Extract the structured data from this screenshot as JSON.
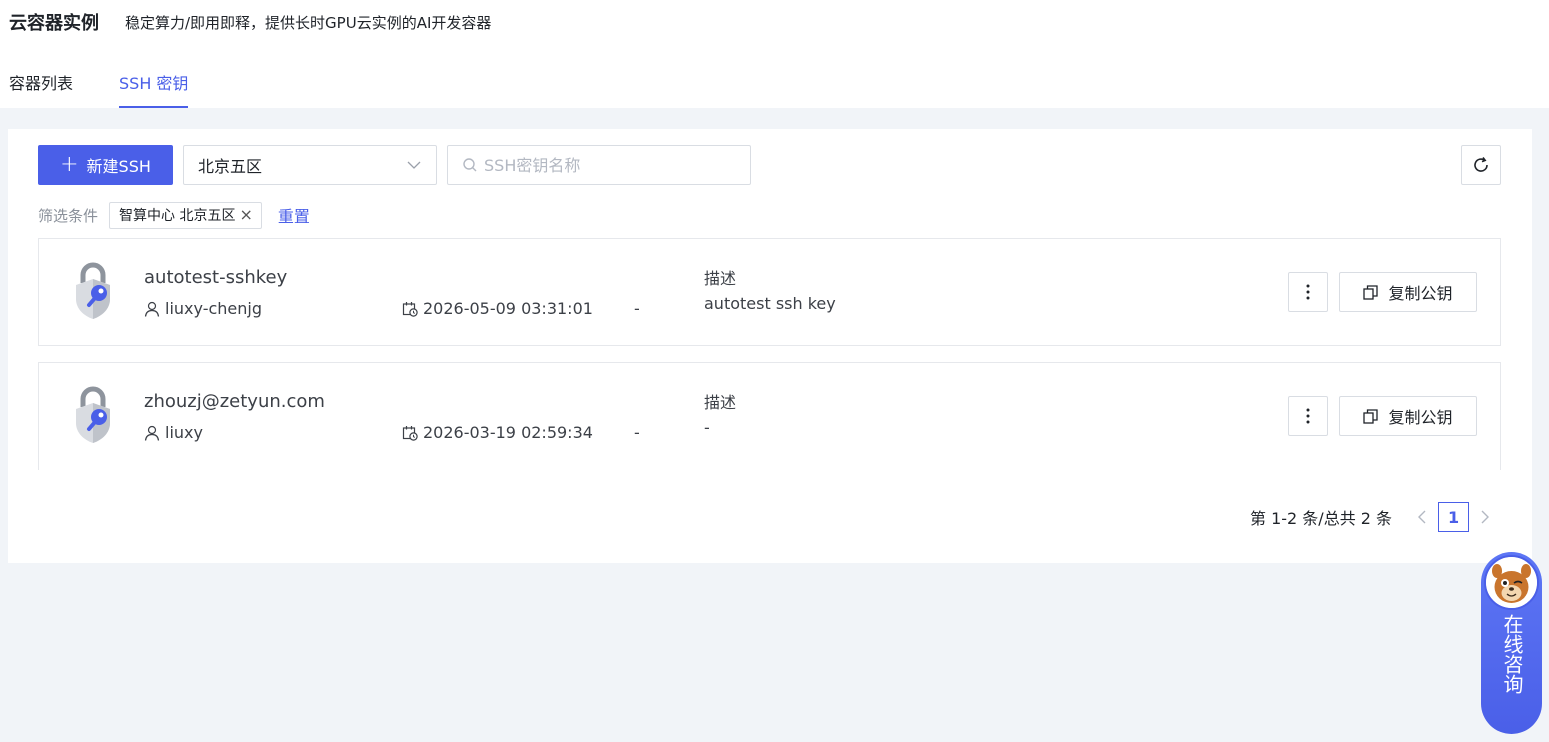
{
  "header": {
    "title": "云容器实例",
    "subtitle": "稳定算力/即用即释，提供长时GPU云实例的AI开发容器"
  },
  "tabs": [
    {
      "label": "容器列表",
      "active": false
    },
    {
      "label": "SSH 密钥",
      "active": true
    }
  ],
  "toolbar": {
    "new_button_label": "新建SSH",
    "region_selected": "北京五区",
    "search_placeholder": "SSH密钥名称"
  },
  "filter": {
    "label": "筛选条件",
    "tag": "智算中心 北京五区",
    "reset_label": "重置"
  },
  "keys": [
    {
      "name": "autotest-sshkey",
      "user": "liuxy-chenjg",
      "created": "2026-05-09 03:31:01",
      "extra": "-",
      "desc_label": "描述",
      "desc": "autotest ssh key",
      "copy_label": "复制公钥"
    },
    {
      "name": "zhouzj@zetyun.com",
      "user": "liuxy",
      "created": "2026-03-19 02:59:34",
      "extra": "-",
      "desc_label": "描述",
      "desc": "-",
      "copy_label": "复制公钥"
    }
  ],
  "pagination": {
    "summary": "第 1-2 条/总共 2 条",
    "current_page": "1"
  },
  "consult": {
    "label": "在线咨询"
  },
  "colors": {
    "primary": "#4a5fe8",
    "background": "#f1f4f8",
    "border": "#d9dde3"
  }
}
